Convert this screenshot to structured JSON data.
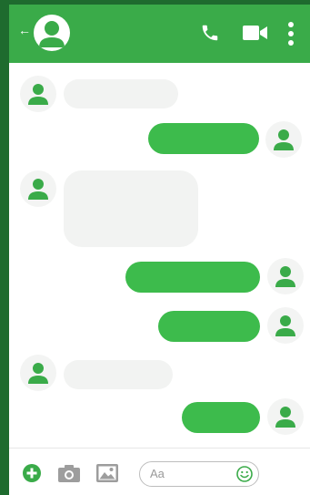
{
  "header": {
    "icons": [
      "back-arrow-icon",
      "user-icon",
      "phone-icon",
      "video-camera-icon",
      "more-vertical-icon"
    ]
  },
  "messages": [
    {
      "direction": "incoming"
    },
    {
      "direction": "outgoing"
    },
    {
      "direction": "incoming"
    },
    {
      "direction": "outgoing"
    },
    {
      "direction": "outgoing"
    },
    {
      "direction": "incoming"
    },
    {
      "direction": "outgoing"
    }
  ],
  "composer": {
    "placeholder": "Aa",
    "icons": [
      "add-icon",
      "camera-icon",
      "image-icon",
      "emoji-icon"
    ]
  },
  "colors": {
    "accent": "#3aab49",
    "outgoing_bubble": "#3dbb4c",
    "incoming_bubble": "#f2f3f2",
    "side_bar": "#1e6b2e"
  }
}
